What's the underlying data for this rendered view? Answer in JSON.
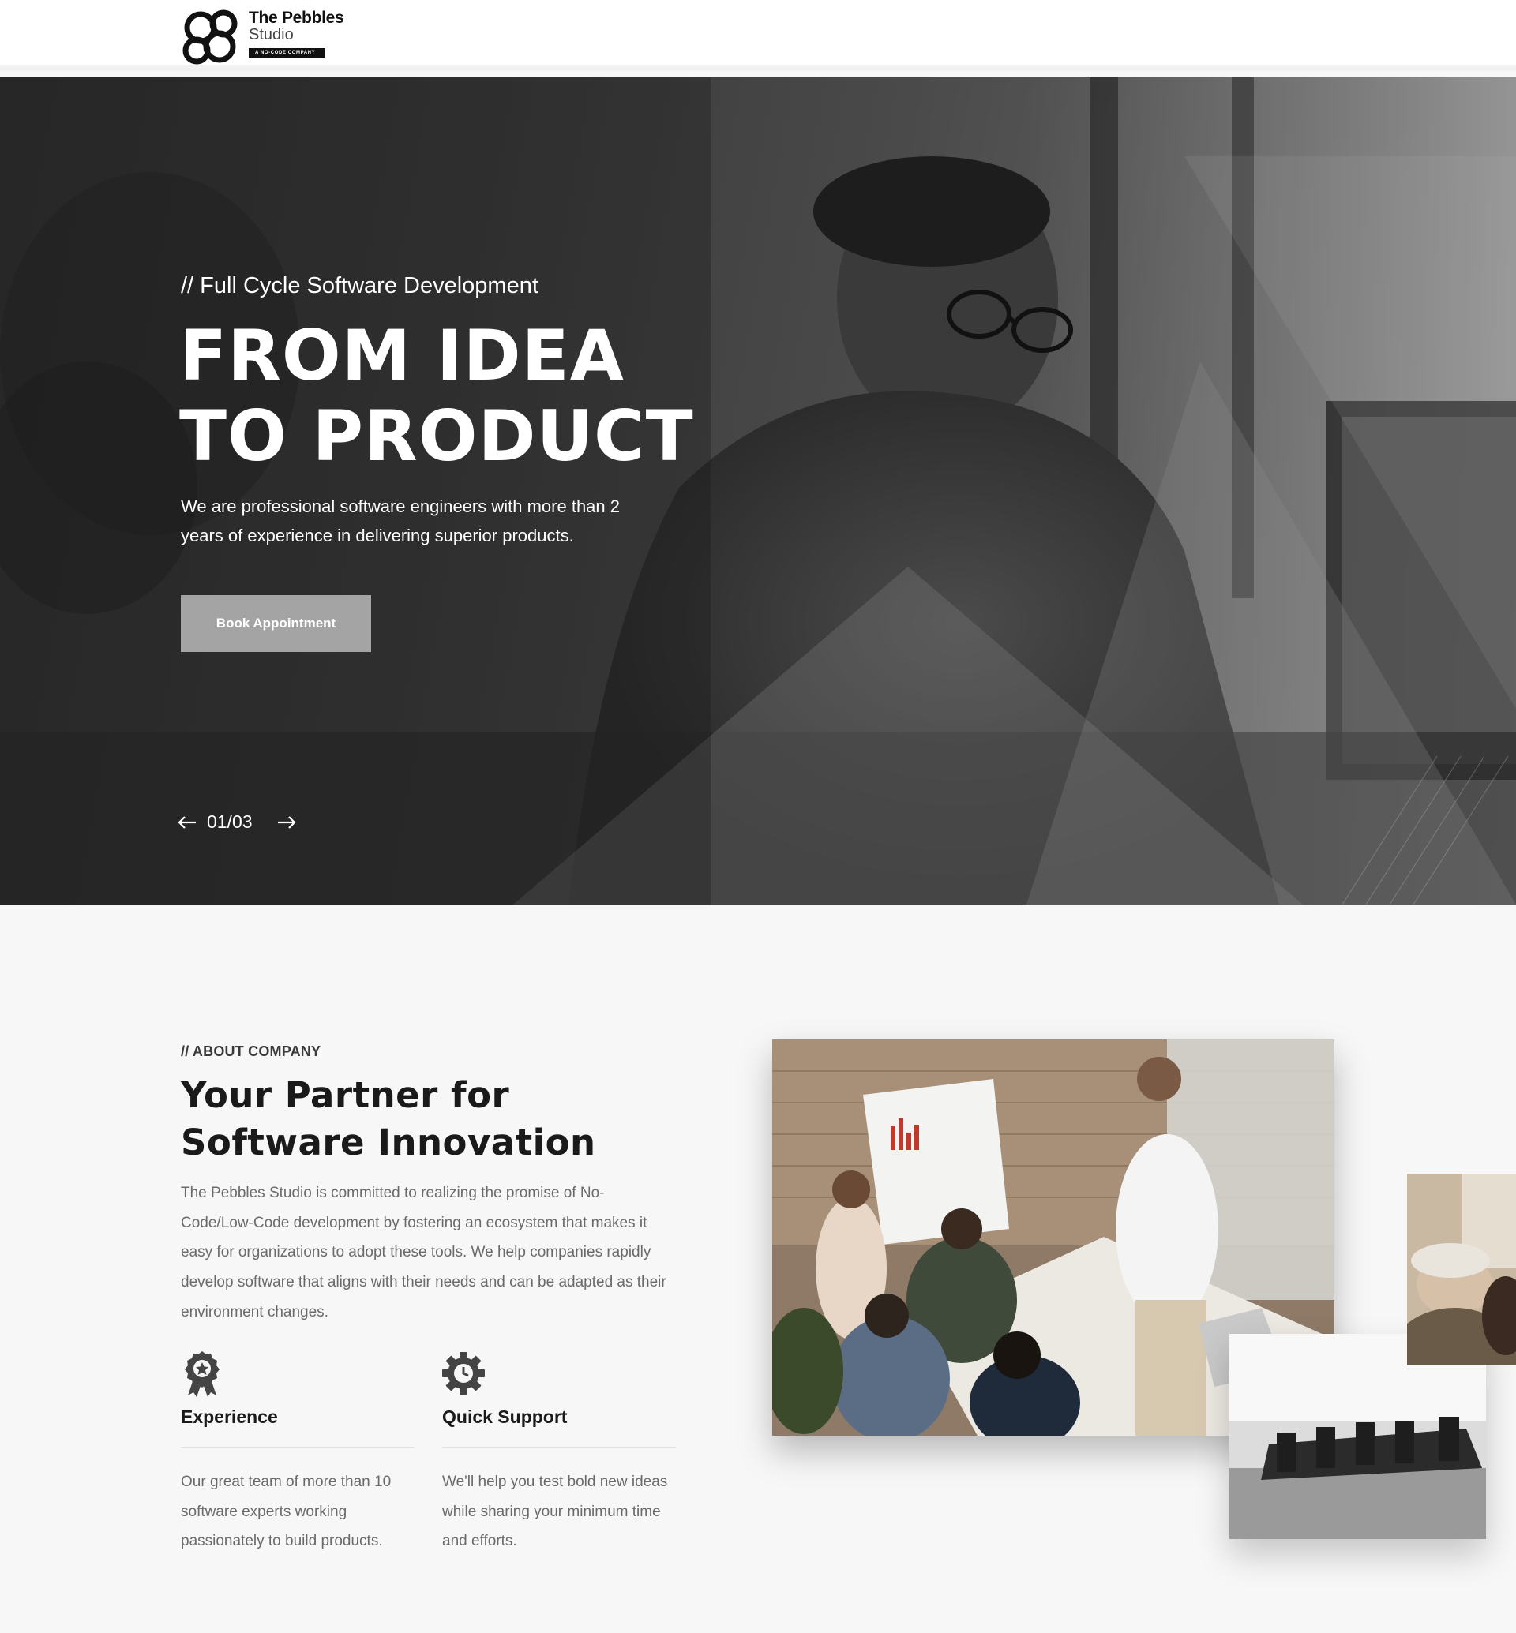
{
  "brand": {
    "name_line1": "The Pebbles",
    "name_line2": "Studio",
    "tagline": "A NO-CODE COMPANY",
    "accent": "#111111"
  },
  "hero": {
    "kicker": "// Full Cycle Software Development",
    "title_line1": "FROM IDEA",
    "title_line2": "TO PRODUCT",
    "description": "We are professional software engineers with more than 2 years of experience in delivering superior products.",
    "cta_label": "Book Appointment",
    "cta_color": "#a4a4a4",
    "slider": {
      "current": "01/03",
      "prev_icon": "arrow-left-icon",
      "next_icon": "arrow-right-icon"
    }
  },
  "about": {
    "kicker": "// ABOUT COMPANY",
    "title_line1": "Your Partner for",
    "title_line2": "Software Innovation",
    "body": "The Pebbles Studio is committed to realizing the promise of No-Code/Low-Code development by fostering an ecosystem that makes it easy for organizations to adopt these tools. We help companies rapidly develop software that aligns with their needs and can be adapted as their environment changes.",
    "features": [
      {
        "icon": "award-badge-icon",
        "title": "Experience",
        "description": "Our great team of more than 10 software experts working passionately to build products."
      },
      {
        "icon": "gear-clock-icon",
        "title": "Quick Support",
        "description": "We'll help you test bold new ideas while sharing your minimum time and efforts."
      }
    ]
  }
}
